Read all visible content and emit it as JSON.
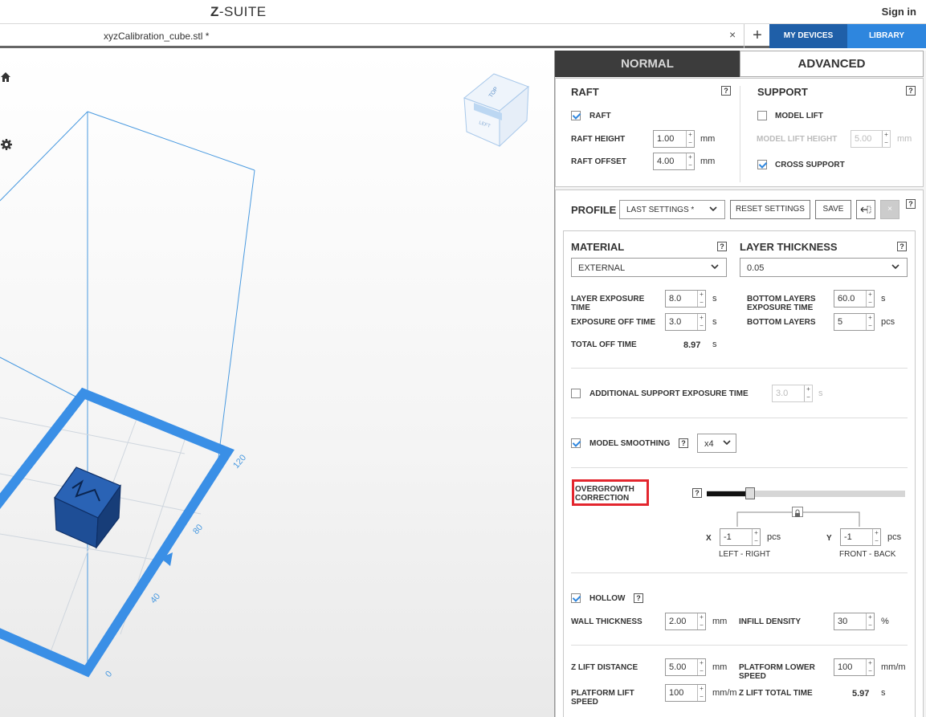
{
  "app": {
    "logo_mark": "Z",
    "logo_text": "-SUITE",
    "signin": "Sign in"
  },
  "tabs": {
    "file": "xyzCalibration_cube.stl *",
    "close": "×",
    "add": "+",
    "my_devices": "MY DEVICES",
    "library": "LIBRARY"
  },
  "viewport": {
    "axis_labels": [
      "0",
      "40",
      "80",
      "120"
    ],
    "cube_faces": {
      "top": "TOP",
      "left": "LEFT"
    },
    "colors": {
      "platform": "#3a8fe6",
      "model": "#1e4e96",
      "volume_lines": "#4a9ae0"
    }
  },
  "mode": {
    "normal": "NORMAL",
    "advanced": "ADVANCED",
    "active": "ADVANCED"
  },
  "raft": {
    "title": "RAFT",
    "help": "?",
    "raft_check": {
      "label": "RAFT",
      "checked": true
    },
    "height": {
      "label": "RAFT HEIGHT",
      "value": "1.00",
      "unit": "mm"
    },
    "offset": {
      "label": "RAFT OFFSET",
      "value": "4.00",
      "unit": "mm"
    }
  },
  "support": {
    "title": "SUPPORT",
    "help": "?",
    "model_lift": {
      "label": "MODEL LIFT",
      "checked": false
    },
    "model_lift_height": {
      "label": "MODEL LIFT HEIGHT",
      "value": "5.00",
      "unit": "mm"
    },
    "cross_support": {
      "label": "CROSS SUPPORT",
      "checked": true
    }
  },
  "profile": {
    "label": "PROFILE",
    "selected": "LAST SETTINGS *",
    "reset": "RESET SETTINGS",
    "save": "SAVE",
    "export_icon": "←⃞",
    "delete_icon": "×",
    "help": "?"
  },
  "material": {
    "title": "MATERIAL",
    "selected": "EXTERNAL",
    "help": "?"
  },
  "layer_thickness": {
    "title": "LAYER THICKNESS",
    "selected": "0.05",
    "help": "?"
  },
  "exposure": {
    "layer_exposure": {
      "label": "LAYER EXPOSURE TIME",
      "value": "8.0",
      "unit": "s"
    },
    "exposure_off": {
      "label": "EXPOSURE OFF TIME",
      "value": "3.0",
      "unit": "s"
    },
    "total_off": {
      "label": "TOTAL OFF TIME",
      "value": "8.97",
      "unit": "s"
    },
    "bottom_exposure": {
      "label": "BOTTOM LAYERS EXPOSURE TIME",
      "value": "60.0",
      "unit": "s"
    },
    "bottom_layers": {
      "label": "BOTTOM LAYERS",
      "value": "5",
      "unit": "pcs"
    }
  },
  "additional_support": {
    "label": "ADDITIONAL SUPPORT EXPOSURE TIME",
    "checked": false,
    "value": "3.0",
    "unit": "s"
  },
  "smoothing": {
    "label": "MODEL SMOOTHING",
    "checked": true,
    "selected": "x4",
    "help": "?"
  },
  "overgrowth": {
    "label": "OVERGROWTH CORRECTION",
    "help": "?",
    "slider_fraction": 0.22,
    "lock_icon": "lock",
    "x": {
      "axis": "X",
      "value": "-1",
      "unit": "pcs",
      "caption": "LEFT - RIGHT"
    },
    "y": {
      "axis": "Y",
      "value": "-1",
      "unit": "pcs",
      "caption": "FRONT - BACK"
    }
  },
  "hollow": {
    "label": "HOLLOW",
    "checked": true,
    "help": "?",
    "wall": {
      "label": "WALL THICKNESS",
      "value": "2.00",
      "unit": "mm"
    },
    "infill": {
      "label": "INFILL DENSITY",
      "value": "30",
      "unit": "%"
    }
  },
  "lift": {
    "z_lift_distance": {
      "label": "Z LIFT DISTANCE",
      "value": "5.00",
      "unit": "mm"
    },
    "platform_lower_speed": {
      "label": "PLATFORM LOWER SPEED",
      "value": "100",
      "unit": "mm/m"
    },
    "platform_lift_speed": {
      "label": "PLATFORM LIFT SPEED",
      "value": "100",
      "unit": "mm/m"
    },
    "z_lift_total_time": {
      "label": "Z LIFT TOTAL TIME",
      "value": "5.97",
      "unit": "s"
    }
  }
}
